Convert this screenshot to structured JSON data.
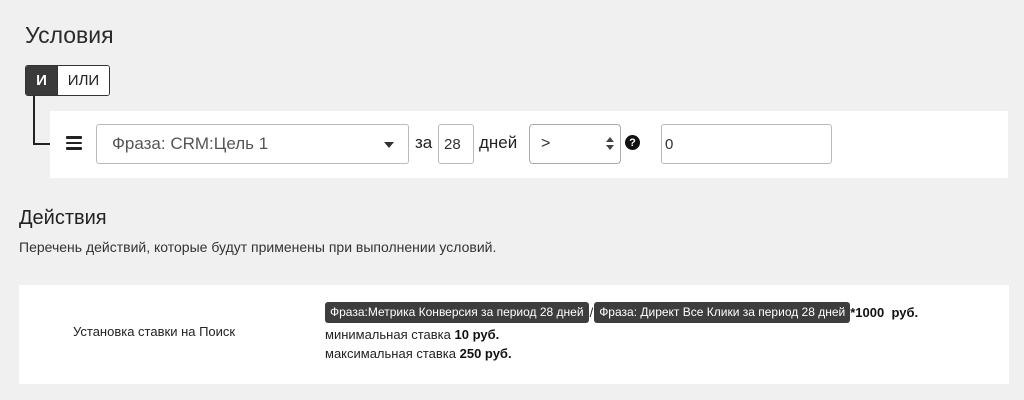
{
  "conditions": {
    "title": "Условия",
    "logic": {
      "and_label": "И",
      "or_label": "ИЛИ",
      "selected": "И"
    },
    "row": {
      "metric_value": "Фраза: CRM:Цель 1",
      "for_label": "за",
      "days_value": "28",
      "days_label": "дней",
      "operator_value": ">",
      "threshold_value": "0"
    }
  },
  "actions": {
    "title": "Действия",
    "description": "Перечень действий, которые будут применены при выполнении условий.",
    "items": [
      {
        "name": "Установка ставки на Поиск",
        "formula": {
          "tag1": "Фраза:Метрика Конверсия за период 28 дней",
          "separator": "/",
          "tag2": "Фраза: Директ Все Клики за период 28 дней",
          "multiplier": "*1000  руб."
        },
        "min_label": "минимальная ставка",
        "min_value": "10  руб.",
        "max_label": "максимальная ставка",
        "max_value": "250  руб."
      }
    ]
  }
}
